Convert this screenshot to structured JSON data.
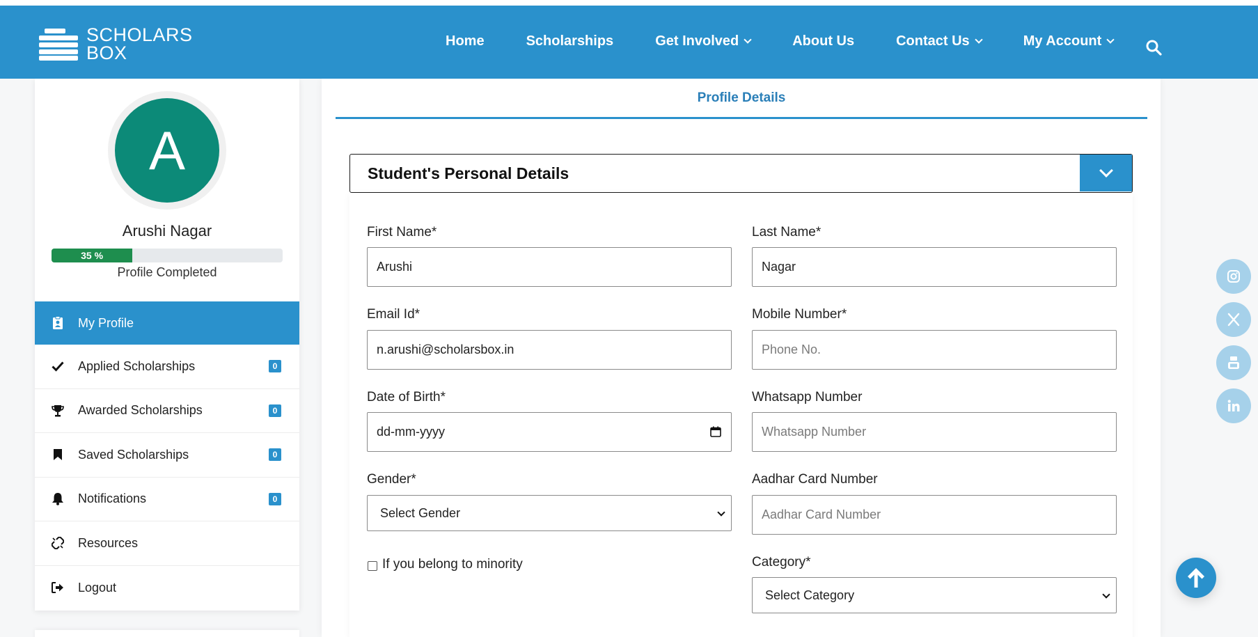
{
  "brand": {
    "line1": "SCHOLARS",
    "line2": "BOX"
  },
  "nav": {
    "home": "Home",
    "scholarships": "Scholarships",
    "get_involved": "Get Involved",
    "about": "About Us",
    "contact": "Contact Us",
    "account": "My Account"
  },
  "profile": {
    "initial": "A",
    "name": "Arushi Nagar",
    "progress_value": 35,
    "progress_text": "35 %",
    "progress_label": "Profile Completed"
  },
  "sidebar": {
    "items": [
      {
        "label": "My Profile",
        "icon": "profile-icon"
      },
      {
        "label": "Applied Scholarships",
        "icon": "check-icon",
        "count": "0"
      },
      {
        "label": "Awarded Scholarships",
        "icon": "trophy-icon",
        "count": "0"
      },
      {
        "label": "Saved Scholarships",
        "icon": "bookmark-icon",
        "count": "0"
      },
      {
        "label": "Notifications",
        "icon": "bell-icon",
        "count": "0"
      },
      {
        "label": "Resources",
        "icon": "link-icon"
      },
      {
        "label": "Logout",
        "icon": "logout-icon"
      }
    ]
  },
  "main": {
    "tab": "Profile Details",
    "section_title": "Student's Personal Details",
    "form": {
      "first_name": {
        "label": "First Name*",
        "value": "Arushi"
      },
      "last_name": {
        "label": "Last Name*",
        "value": "Nagar"
      },
      "email": {
        "label": "Email Id*",
        "value": "n.arushi@scholarsbox.in"
      },
      "mobile": {
        "label": "Mobile Number*",
        "placeholder": "Phone No."
      },
      "dob": {
        "label": "Date of Birth*",
        "placeholder": "dd-mm-yyyy"
      },
      "whatsapp": {
        "label": "Whatsapp Number",
        "placeholder": "Whatsapp Number"
      },
      "gender": {
        "label": "Gender*",
        "selected": "Select Gender"
      },
      "aadhar": {
        "label": "Aadhar Card Number",
        "placeholder": "Aadhar Card Number"
      },
      "minority": {
        "label": "If you belong to minority",
        "checked": false
      },
      "category": {
        "label": "Category*",
        "selected": "Select Category"
      }
    }
  },
  "social": [
    "instagram-icon",
    "x-icon",
    "youtube-icon",
    "linkedin-icon"
  ],
  "colors": {
    "primary": "#2a91cc",
    "avatar": "#0c8a78",
    "progress": "#1e8e4e",
    "social": "#a6d1ea"
  }
}
